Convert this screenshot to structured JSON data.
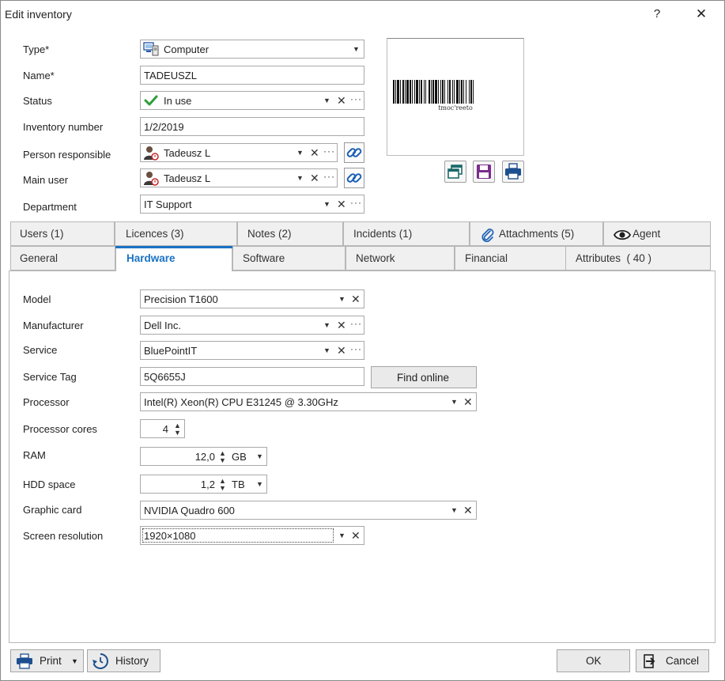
{
  "window": {
    "title": "Edit inventory",
    "help": "?",
    "close": "✕"
  },
  "form": {
    "type": {
      "label": "Type*",
      "value": "Computer"
    },
    "name": {
      "label": "Name*",
      "value": "TADEUSZL"
    },
    "status": {
      "label": "Status",
      "value": "In use"
    },
    "inventory_number": {
      "label": "Inventory number",
      "value": "1/2/2019"
    },
    "person_responsible": {
      "label": "Person responsible",
      "value": "Tadeusz L"
    },
    "main_user": {
      "label": "Main user",
      "value": "Tadeusz L"
    },
    "department": {
      "label": "Department",
      "value": "IT Support"
    }
  },
  "barcode": {
    "text": "tmoc'reeto"
  },
  "tabs_row1": [
    {
      "label": "Users (1)"
    },
    {
      "label": "Licences (3)"
    },
    {
      "label": "Notes (2)"
    },
    {
      "label": "Incidents (1)"
    },
    {
      "label": "Attachments (5)",
      "icon": "paperclip-icon"
    },
    {
      "label": "Agent",
      "icon": "eye-icon"
    }
  ],
  "tabs_row2": [
    {
      "label": "General"
    },
    {
      "label": "Hardware",
      "active": true
    },
    {
      "label": "Software"
    },
    {
      "label": "Network"
    },
    {
      "label": "Financial"
    },
    {
      "label": "Attributes  ( 40 )"
    }
  ],
  "hardware": {
    "model": {
      "label": "Model",
      "value": "Precision T1600"
    },
    "manufacturer": {
      "label": "Manufacturer",
      "value": "Dell Inc."
    },
    "service": {
      "label": "Service",
      "value": "BluePointIT"
    },
    "service_tag": {
      "label": "Service Tag",
      "value": "5Q6655J",
      "button": "Find online"
    },
    "processor": {
      "label": "Processor",
      "value": "Intel(R) Xeon(R) CPU E31245 @ 3.30GHz"
    },
    "processor_cores": {
      "label": "Processor cores",
      "value": "4"
    },
    "ram": {
      "label": "RAM",
      "value": "12,0",
      "unit": "GB"
    },
    "hdd": {
      "label": "HDD space",
      "value": "1,2",
      "unit": "TB"
    },
    "graphic_card": {
      "label": "Graphic card",
      "value": "NVIDIA Quadro 600"
    },
    "screen_resolution": {
      "label": "Screen resolution",
      "value": "1920×1080"
    }
  },
  "footer": {
    "print": "Print",
    "history": "History",
    "ok": "OK",
    "cancel": "Cancel"
  },
  "colors": {
    "accent": "#1a72c4",
    "status_check": "#2e9e3a",
    "link_icon": "#1a5fb4",
    "save_icon": "#7b2c8e"
  }
}
